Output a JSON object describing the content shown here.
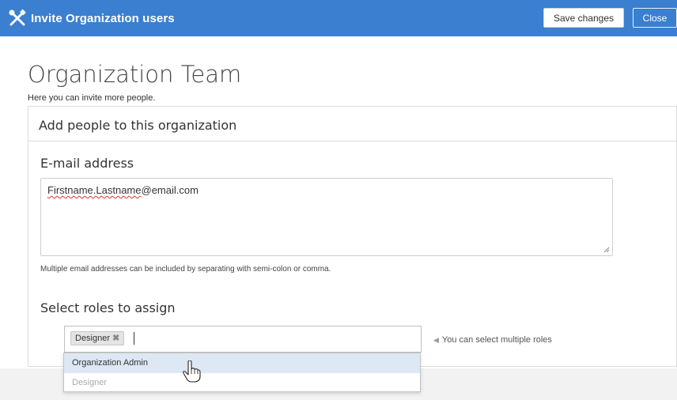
{
  "header": {
    "title": "Invite Organization users",
    "save_label": "Save changes",
    "close_label": "Close",
    "icon": "tools-icon",
    "bar_color": "#3a7fd0"
  },
  "page": {
    "title": "Organization Team",
    "subtitle": "Here you can invite more people."
  },
  "card": {
    "header": "Add people to this organization",
    "email": {
      "label": "E-mail address",
      "value_misspelled": "Firstname.Lastname",
      "value_rest": "@email.com",
      "hint": "Multiple email addresses can be included by separating with semi-colon or comma."
    },
    "roles": {
      "label": "Select roles to assign",
      "selected_tag": "Designer",
      "hint": "You can select multiple roles",
      "options": [
        {
          "label": "Organization Admin",
          "state": "highlighted"
        },
        {
          "label": "Designer",
          "state": "disabled"
        }
      ]
    }
  }
}
